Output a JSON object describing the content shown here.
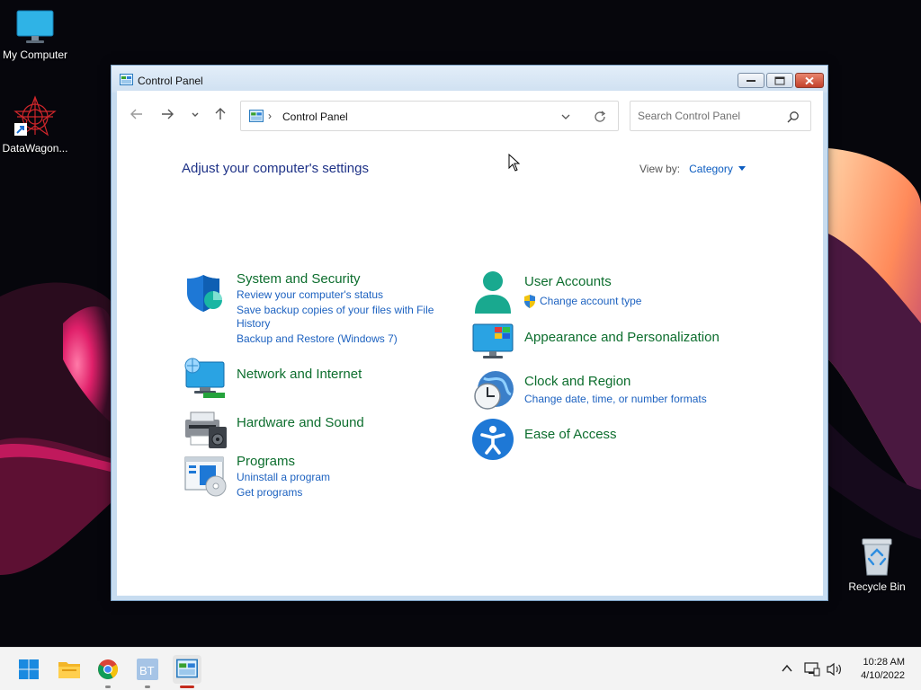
{
  "desktop": {
    "icons": [
      {
        "label": "My Computer",
        "icon": "monitor-icon"
      },
      {
        "label": "DataWagon...",
        "icon": "datawagon-shortcut-icon"
      },
      {
        "label": "Recycle Bin",
        "icon": "recycle-bin-icon"
      }
    ]
  },
  "window": {
    "title": "Control Panel",
    "nav": {
      "back": "back-arrow-icon",
      "forward": "forward-arrow-icon",
      "recent": "chevron-down-icon",
      "up": "up-arrow-icon"
    },
    "address": {
      "breadcrumb_sep": "›",
      "crumb": "Control Panel"
    },
    "search": {
      "placeholder": "Search Control Panel"
    },
    "heading": "Adjust your computer's settings",
    "view_by": {
      "label": "View by:",
      "value": "Category"
    },
    "categories_left": [
      {
        "title": "System and Security",
        "links": [
          "Review your computer's status",
          "Save backup copies of your files with File History",
          "Backup and Restore (Windows 7)"
        ]
      },
      {
        "title": "Network and Internet",
        "links": []
      },
      {
        "title": "Hardware and Sound",
        "links": []
      },
      {
        "title": "Programs",
        "links": [
          "Uninstall a program",
          "Get programs"
        ]
      }
    ],
    "categories_right": [
      {
        "title": "User Accounts",
        "links": [
          "Change account type"
        ]
      },
      {
        "title": "Appearance and Personalization",
        "links": []
      },
      {
        "title": "Clock and Region",
        "links": [
          "Change date, time, or number formats"
        ]
      },
      {
        "title": "Ease of Access",
        "links": []
      }
    ]
  },
  "taskbar": {
    "items": [
      "start-icon",
      "file-explorer-icon",
      "chrome-icon",
      "bt-app-icon",
      "control-panel-icon"
    ],
    "tray": [
      "chevron-up-icon",
      "network-icon",
      "volume-icon"
    ],
    "time": "10:28 AM",
    "date": "4/10/2022"
  },
  "colors": {
    "category_title": "#0d6e2e",
    "link": "#1d62c0",
    "heading": "#1e3287"
  }
}
